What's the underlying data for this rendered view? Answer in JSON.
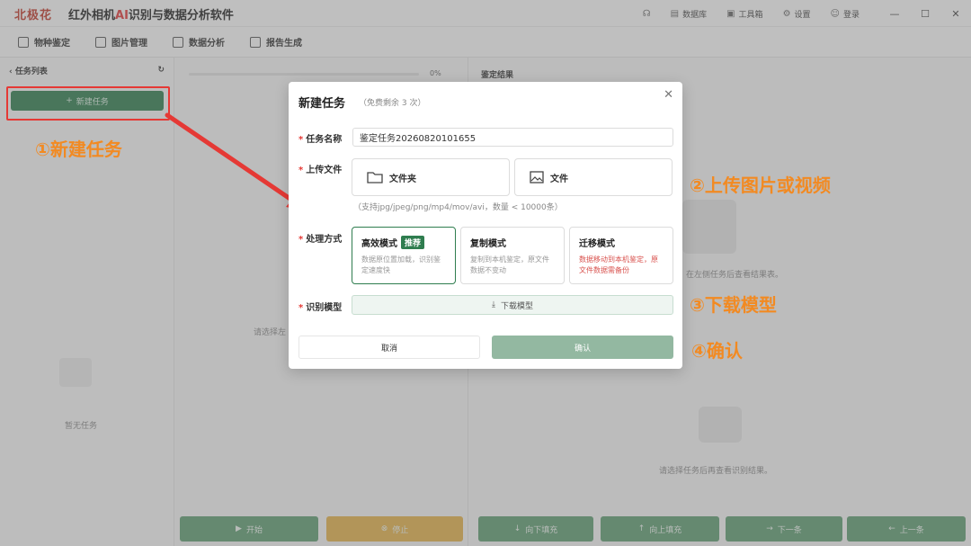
{
  "app": {
    "logo": "北极花",
    "title_prefix": "红外相机",
    "title_ai": "AI",
    "title_suffix": "识别与数据分析软件",
    "topbar": {
      "database": "数据库",
      "toolbox": "工具箱",
      "settings": "设置",
      "login": "登录"
    },
    "menu": {
      "species": "物种鉴定",
      "images": "图片管理",
      "analysis": "数据分析",
      "report": "报告生成"
    },
    "left_panel": {
      "title": "任务列表",
      "new_task": "新建任务",
      "empty": "暂无任务"
    },
    "middle_panel": {
      "progress_value": "0%",
      "empty": "请选择左"
    },
    "right_panel": {
      "title": "鉴定结果",
      "hint1": "在左侧任务后查看结果表。",
      "hint2": "请选择任务后再查看识别结果。"
    },
    "bottom": {
      "start": "开始",
      "stop": "停止",
      "fill_down": "向下填充",
      "fill_up": "向上填充",
      "next": "下一条",
      "prev": "上一条"
    }
  },
  "dialog": {
    "title": "新建任务",
    "subtitle": "（免费剩余 3 次）",
    "task_name_label": "任务名称",
    "task_name_value": "鉴定任务20260820101655",
    "upload_label": "上传文件",
    "folder_label": "文件夹",
    "file_label": "文件",
    "upload_hint": "（支持jpg/jpeg/png/mp4/mov/avi，数量 < 10000条）",
    "mode_label": "处理方式",
    "modes": [
      {
        "title": "高效模式",
        "badge": "推荐",
        "desc": "数据原位置加载，识别鉴定速度快"
      },
      {
        "title": "复制模式",
        "desc": "复制到本机鉴定，原文件数据不变动"
      },
      {
        "title": "迁移模式",
        "desc": "数据移动到本机鉴定，原文件数据需备份"
      }
    ],
    "model_label": "识别模型",
    "download_model": "下载模型",
    "cancel": "取消",
    "confirm": "确认"
  },
  "annotations": {
    "step1": "①新建任务",
    "step2": "②上传图片或视频",
    "step3": "③下载模型",
    "step4": "④确认"
  },
  "colors": {
    "brand_green": "#2f7d4f",
    "annotation_orange": "#f28a22",
    "highlight_red": "#e53935"
  }
}
